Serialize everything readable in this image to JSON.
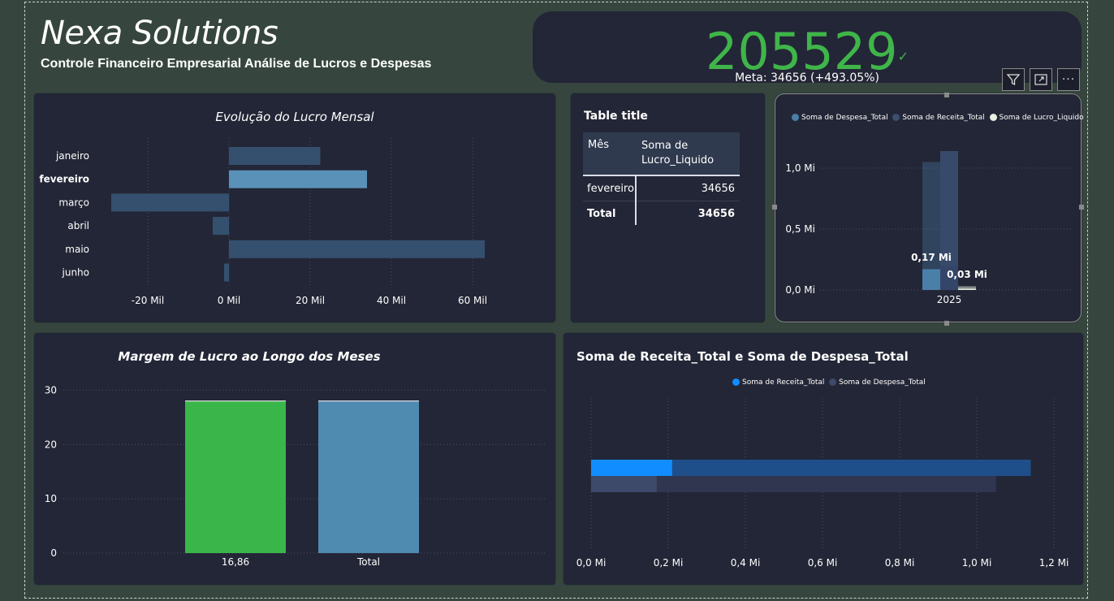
{
  "header": {
    "company": "Nexa Solutions",
    "subtitle": "Controle Financeiro Empresarial Análise de Lucros e Despesas"
  },
  "kpi": {
    "value": "205529",
    "check": "✓",
    "goal": "Meta: 34656 (+493.05%)"
  },
  "toolbar": {
    "filter_icon": "filter-icon",
    "focus_icon": "focus-mode-icon",
    "more_label": "···"
  },
  "lucro_mensal": {
    "title": "Evolução do Lucro Mensal",
    "chart_data": {
      "type": "bar",
      "orientation": "horizontal",
      "categories": [
        "janeiro",
        "fevereiro",
        "março",
        "abril",
        "maio",
        "junho"
      ],
      "values": [
        22500,
        34000,
        -29000,
        -4000,
        63000,
        -1200
      ],
      "highlighted": "fevereiro",
      "x_ticks": [
        "-20 Mil",
        "0 Mil",
        "20 Mil",
        "40 Mil",
        "60 Mil"
      ],
      "xlim": [
        -32000,
        68000
      ],
      "colors": {
        "default": "#35506e",
        "highlight": "#5a91b8"
      }
    }
  },
  "table": {
    "title": "Table title",
    "headers": [
      "Mês",
      "Soma de Lucro_Liquido"
    ],
    "rows": [
      [
        "fevereiro",
        "34656"
      ]
    ],
    "total": [
      "Total",
      "34656"
    ]
  },
  "column_chart": {
    "chart_data": {
      "type": "bar",
      "categories": [
        "2025"
      ],
      "series": [
        {
          "name": "Soma de Despesa_Total",
          "values": [
            1.05
          ],
          "color": "#4a7fa8"
        },
        {
          "name": "Soma de Receita_Total",
          "values": [
            1.14
          ],
          "color": "#3b4f70"
        },
        {
          "name": "Soma de Lucro_Liquido",
          "values": [
            0.03
          ],
          "color": "#e8f0e0"
        }
      ],
      "highlight_values": [
        0.17,
        0.2,
        0.03
      ],
      "data_labels": [
        "0,17 Mi",
        "0,03 Mi"
      ],
      "y_ticks": [
        "0,0 Mi",
        "0,5 Mi",
        "1,0 Mi"
      ],
      "ylim": [
        0,
        1.2
      ]
    }
  },
  "margem": {
    "title": "Margem de Lucro ao Longo dos Meses",
    "chart_data": {
      "type": "bar",
      "categories": [
        "16,86",
        "Total"
      ],
      "values": [
        28,
        28
      ],
      "colors": [
        "#3ab54a",
        "#4f8ab1"
      ],
      "y_ticks": [
        "0",
        "10",
        "20",
        "30"
      ],
      "ylim": [
        0,
        32
      ]
    }
  },
  "receita_despesa": {
    "title": "Soma de Receita_Total e Soma de Despesa_Total",
    "chart_data": {
      "type": "bar",
      "orientation": "horizontal",
      "series": [
        {
          "name": "Soma de Receita_Total",
          "values": [
            1.14
          ],
          "highlight": 0.21,
          "color": "#1e4f8a",
          "highlight_color": "#118dff"
        },
        {
          "name": "Soma de Despesa_Total",
          "values": [
            1.05
          ],
          "highlight": 0.17,
          "color": "#313650",
          "highlight_color": "#3e4a6a"
        }
      ],
      "x_ticks": [
        "0,0 Mi",
        "0,2 Mi",
        "0,4 Mi",
        "0,6 Mi",
        "0,8 Mi",
        "1,0 Mi",
        "1,2 Mi"
      ],
      "xlim": [
        0,
        1.2
      ]
    }
  }
}
